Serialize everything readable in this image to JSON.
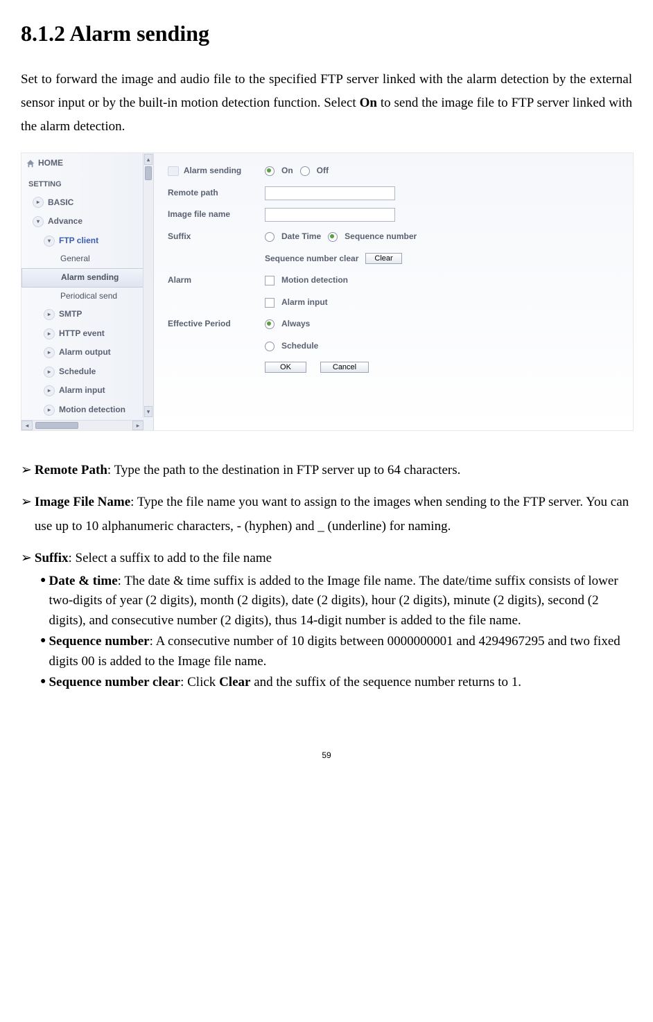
{
  "heading": "8.1.2 Alarm sending",
  "intro_prefix": "Set to forward the image and audio file to the specified FTP server linked with the alarm detection by the external sensor input or by the built-in motion detection function. Select ",
  "intro_bold": "On",
  "intro_suffix": " to send the image file to FTP server linked with the alarm detection.",
  "sidebar": {
    "home": "HOME",
    "setting": "SETTING",
    "basic": "BASIC",
    "advance": "Advance",
    "ftp_client": "FTP client",
    "general": "General",
    "alarm_sending": "Alarm sending",
    "periodical_send": "Periodical send",
    "smtp": "SMTP",
    "http_event": "HTTP event",
    "alarm_output": "Alarm output",
    "schedule": "Schedule",
    "alarm_input": "Alarm input",
    "motion_detection": "Motion detection"
  },
  "form": {
    "alarm_sending_label": "Alarm sending",
    "on": "On",
    "off": "Off",
    "remote_path": "Remote path",
    "image_file_name": "Image file name",
    "suffix": "Suffix",
    "date_time": "Date Time",
    "sequence_number": "Sequence number",
    "seq_clear_label": "Sequence number clear",
    "clear_btn": "Clear",
    "alarm_label": "Alarm",
    "motion_detection": "Motion detection",
    "alarm_input": "Alarm input",
    "effective_period": "Effective Period",
    "always": "Always",
    "schedule": "Schedule",
    "ok": "OK",
    "cancel": "Cancel"
  },
  "defs": {
    "remote_path_bold": "Remote Path",
    "remote_path_text": ": Type the path to the destination in FTP server up to 64 characters.",
    "image_file_bold": "Image File Name",
    "image_file_text": ": Type the file name you want to assign to the images when sending to the FTP server. You can use up to 10 alphanumeric characters, - (hyphen) and _ (underline) for naming.",
    "suffix_bold": "Suffix",
    "suffix_text": ": Select a suffix to add to the file name",
    "date_time_bold": "Date & time",
    "date_time_text": ": The date & time suffix is added to the Image file name. The date/time suffix consists of lower two-digits of year (2 digits), month (2 digits), date (2 digits), hour (2 digits), minute (2 digits), second (2 digits), and consecutive number (2 digits), thus 14-digit number is added to the file name.",
    "seq_num_bold": "Sequence number",
    "seq_num_text": ": A consecutive number of 10 digits between 0000000001 and 4294967295 and two fixed digits 00 is added to the Image file name.",
    "seq_clear_bold": "Sequence number clear",
    "seq_clear_pre": ": Click ",
    "seq_clear_mid_bold": "Clear",
    "seq_clear_post": " and the suffix of the sequence number returns to 1."
  },
  "page_number": "59"
}
